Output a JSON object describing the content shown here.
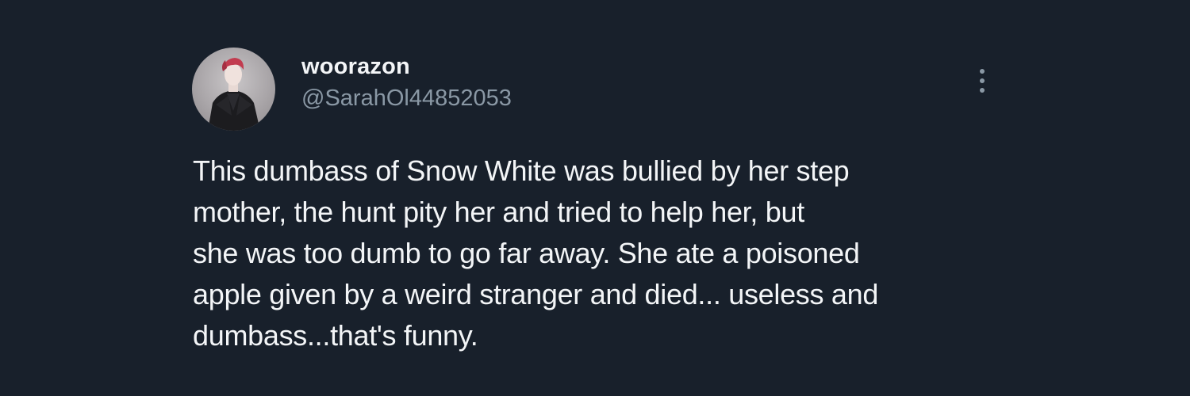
{
  "author": {
    "display_name": "woorazon",
    "handle": "@SarahOl44852053",
    "avatar_icon": "profile-photo"
  },
  "more_menu_icon": "more-vertical-icon",
  "tweet": {
    "lines": [
      "This dumbass of Snow White was bullied by her step",
      "mother, the hunt pity her and tried to help her, but",
      "she was too dumb to go far away. She ate a poisoned",
      "apple given by a weird stranger and died... useless and",
      "dumbass...that's funny."
    ]
  },
  "colors": {
    "background": "#18202b",
    "primary_text": "#f3f5f7",
    "secondary_text": "#8a98a5"
  }
}
